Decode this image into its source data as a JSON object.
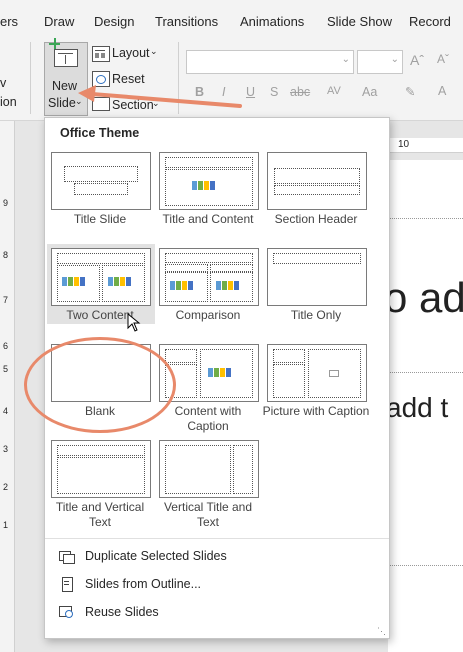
{
  "tabs": [
    "ers",
    "Draw",
    "Design",
    "Transitions",
    "Animations",
    "Slide Show",
    "Record"
  ],
  "ribbon": {
    "left_partial": [
      "v",
      "ion"
    ],
    "new_slide": [
      "New",
      "Slide"
    ],
    "layout": "Layout",
    "reset": "Reset",
    "section": "Section",
    "font_buttons": [
      "B",
      "I",
      "U",
      "S",
      "abc",
      "AV",
      "Aa"
    ]
  },
  "ruler_top_label": "10",
  "ruler_left_labels": [
    "9",
    "8",
    "7",
    "6",
    "5",
    "4",
    "3",
    "2",
    "1"
  ],
  "slide_text": [
    "o ad",
    "add t"
  ],
  "gallery": {
    "title": "Office Theme",
    "layouts": [
      {
        "name": "Title Slide"
      },
      {
        "name": "Title and Content"
      },
      {
        "name": "Section Header"
      },
      {
        "name": "Two Content"
      },
      {
        "name": "Comparison"
      },
      {
        "name": "Title Only"
      },
      {
        "name": "Blank"
      },
      {
        "name": "Content with Caption"
      },
      {
        "name": "Picture with Caption"
      },
      {
        "name": "Title and Vertical Text"
      },
      {
        "name": "Vertical Title and Text"
      }
    ],
    "menu": [
      "Duplicate Selected Slides",
      "Slides from Outline...",
      "Reuse Slides"
    ]
  },
  "colors": {
    "annotation": "#e8896a",
    "accent_green": "#3aa655"
  }
}
